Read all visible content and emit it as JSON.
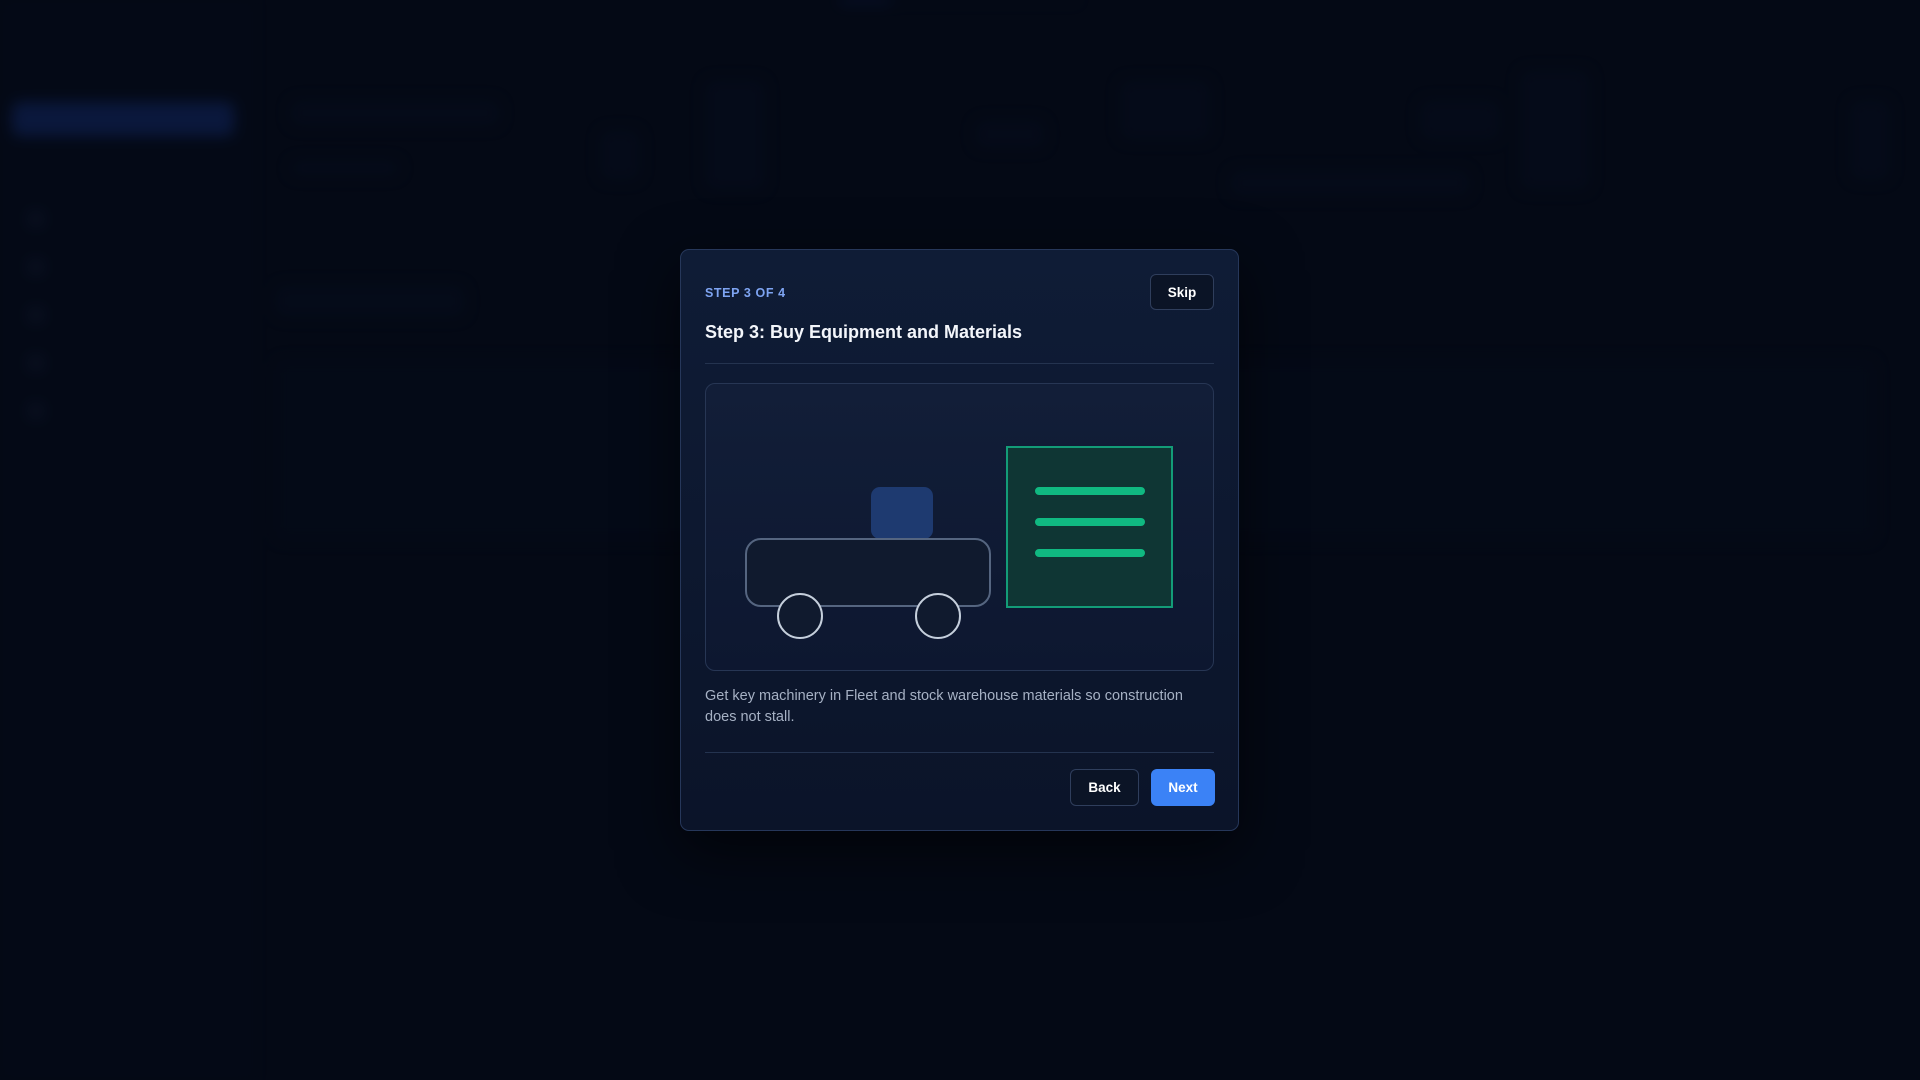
{
  "modal": {
    "step_label": "STEP 3 OF 4",
    "skip_label": "Skip",
    "title": "Step 3: Buy Equipment and Materials",
    "description": "Get key machinery in Fleet and stock warehouse materials so construction does not stall.",
    "back_label": "Back",
    "next_label": "Next",
    "illustration_icons": [
      "truck-icon",
      "document-icon"
    ]
  },
  "colors": {
    "accent": "#3b82f6",
    "step_label": "#7ea4f2",
    "document_green": "#10b981",
    "truck_cargo": "#1e3a70"
  }
}
